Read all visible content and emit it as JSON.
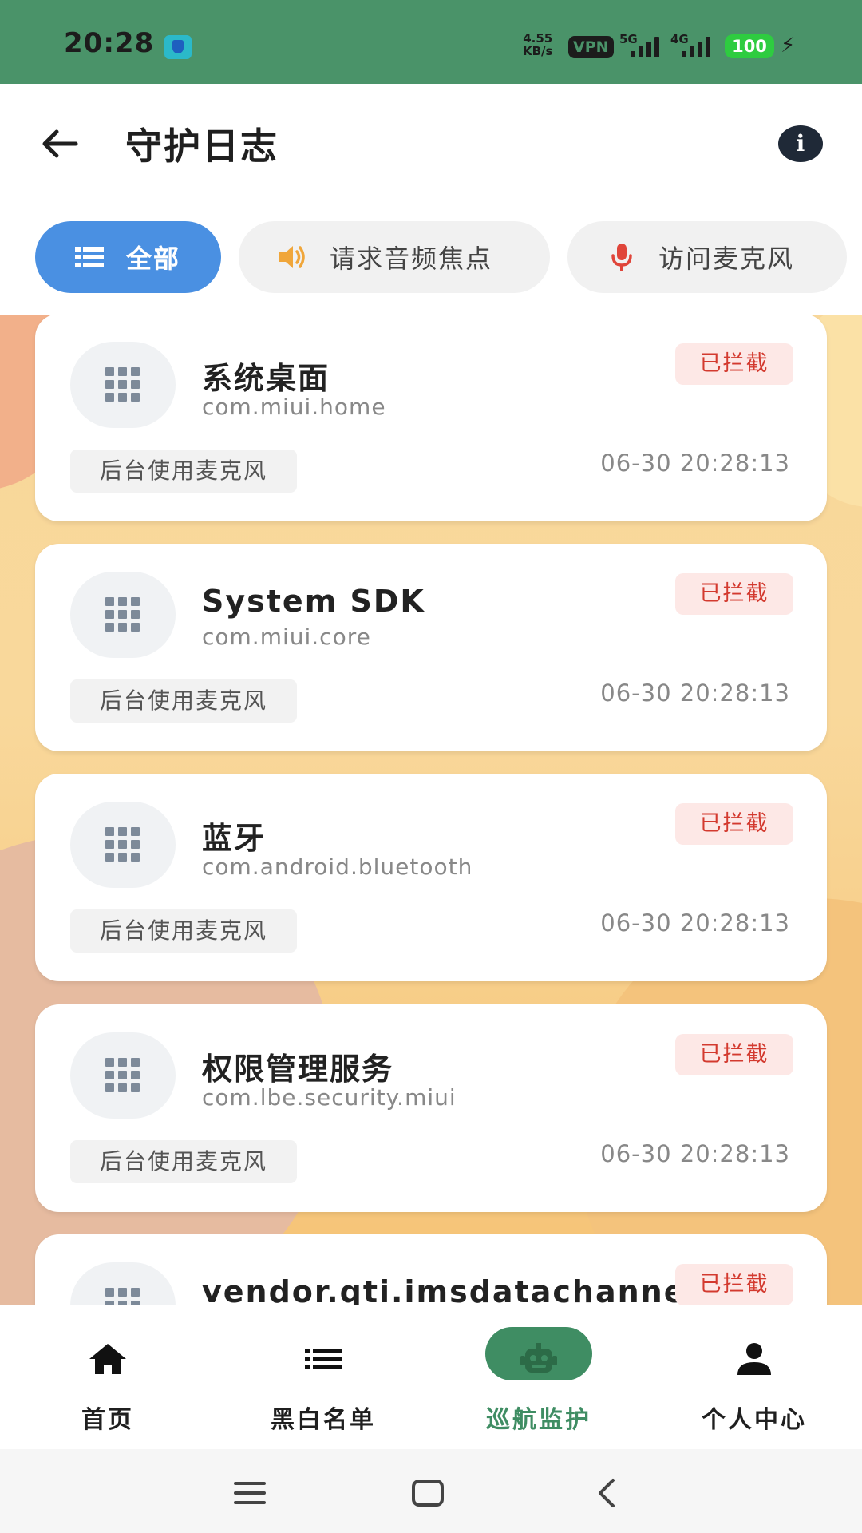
{
  "status_bar": {
    "time": "20:28",
    "net_speed_value": "4.55",
    "net_speed_unit": "KB/s",
    "vpn": "VPN",
    "sim1": "5G",
    "sim2": "4G",
    "battery": "100"
  },
  "header": {
    "title": "守护日志"
  },
  "filters": [
    {
      "label": "全部",
      "icon": "list-icon",
      "active": true
    },
    {
      "label": "请求音频焦点",
      "icon": "speaker-icon",
      "active": false
    },
    {
      "label": "访问麦克风",
      "icon": "microphone-icon",
      "active": false
    }
  ],
  "logs": [
    {
      "app_name": "系统桌面",
      "package": "com.miui.home",
      "status": "已拦截",
      "action": "后台使用麦克风",
      "time": "06-30 20:28:13"
    },
    {
      "app_name": "System SDK",
      "package": "com.miui.core",
      "status": "已拦截",
      "action": "后台使用麦克风",
      "time": "06-30 20:28:13"
    },
    {
      "app_name": "蓝牙",
      "package": "com.android.bluetooth",
      "status": "已拦截",
      "action": "后台使用麦克风",
      "time": "06-30 20:28:13"
    },
    {
      "app_name": "权限管理服务",
      "package": "com.lbe.security.miui",
      "status": "已拦截",
      "action": "后台使用麦克风",
      "time": "06-30 20:28:13"
    },
    {
      "app_name": "vendor.qti.imsdatachannel",
      "status": "已拦截"
    }
  ],
  "bottom_nav": [
    {
      "label": "首页",
      "icon": "home-icon"
    },
    {
      "label": "黑白名单",
      "icon": "list-icon"
    },
    {
      "label": "巡航监护",
      "icon": "robot-icon",
      "active": true
    },
    {
      "label": "个人中心",
      "icon": "person-icon"
    }
  ],
  "colors": {
    "status_bar": "#4a9369",
    "accent_blue": "#4a90e2",
    "accent_green": "#3f8d63",
    "blocked_red": "#d33a2f"
  }
}
